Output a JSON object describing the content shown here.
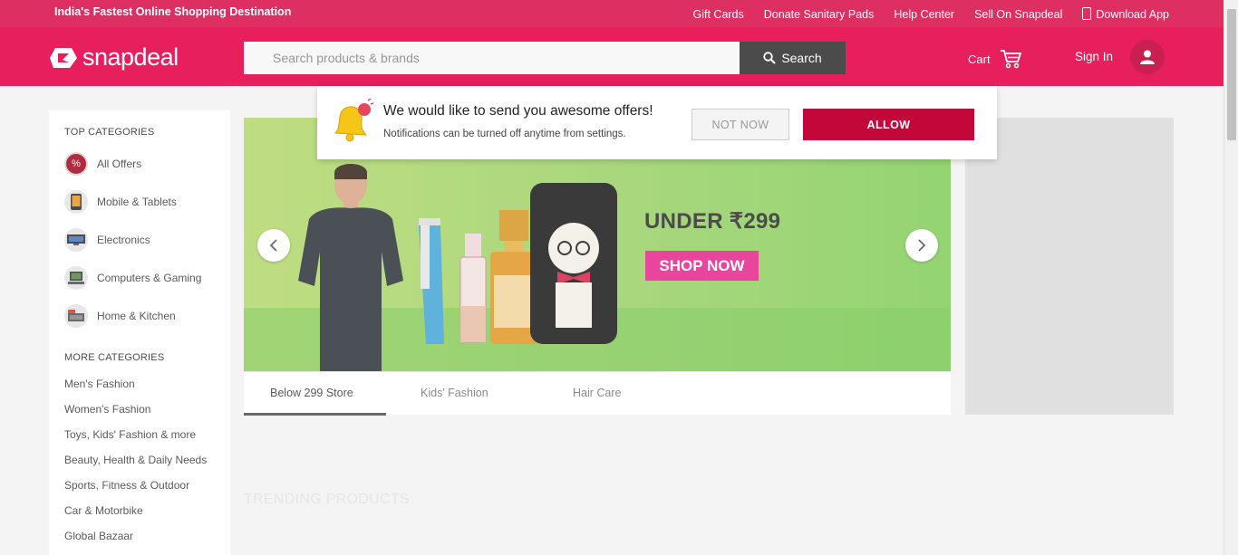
{
  "topbar": {
    "tagline": "India's Fastest Online Shopping Destination",
    "links": [
      "Gift Cards",
      "Donate Sanitary Pads",
      "Help Center",
      "Sell On Snapdeal",
      "Download App"
    ]
  },
  "header": {
    "logo_text": "snapdeal",
    "search_placeholder": "Search products & brands",
    "search_button": "Search",
    "cart_label": "Cart",
    "signin_label": "Sign In"
  },
  "notification": {
    "title": "We would like to send you awesome offers!",
    "subtitle": "Notifications can be turned off anytime from settings.",
    "not_now": "NOT NOW",
    "allow": "ALLOW"
  },
  "sidebar": {
    "top_heading": "TOP CATEGORIES",
    "top_categories": [
      {
        "label": "All Offers",
        "icon": "percent-icon"
      },
      {
        "label": "Mobile & Tablets",
        "icon": "mobile-icon"
      },
      {
        "label": "Electronics",
        "icon": "electronics-icon"
      },
      {
        "label": "Computers & Gaming",
        "icon": "computer-icon"
      },
      {
        "label": "Home & Kitchen",
        "icon": "home-icon"
      }
    ],
    "more_heading": "MORE CATEGORIES",
    "more_categories": [
      "Men's Fashion",
      "Women's Fashion",
      "Toys, Kids' Fashion & more",
      "Beauty, Health & Daily Needs",
      "Sports, Fitness & Outdoor",
      "Car & Motorbike",
      "Global Bazaar"
    ]
  },
  "banner": {
    "headline": "UNDER ₹299",
    "cta": "SHOP NOW",
    "tabs": [
      "Below 299 Store",
      "Kids' Fashion",
      "Hair Care"
    ],
    "active_tab": 0
  },
  "sections": {
    "trending": "TRENDING PRODUCTS"
  },
  "colors": {
    "brand": "#e40046",
    "topstrip": "#d9134d",
    "allow": "#c3073a",
    "cta": "#e62c8f"
  }
}
